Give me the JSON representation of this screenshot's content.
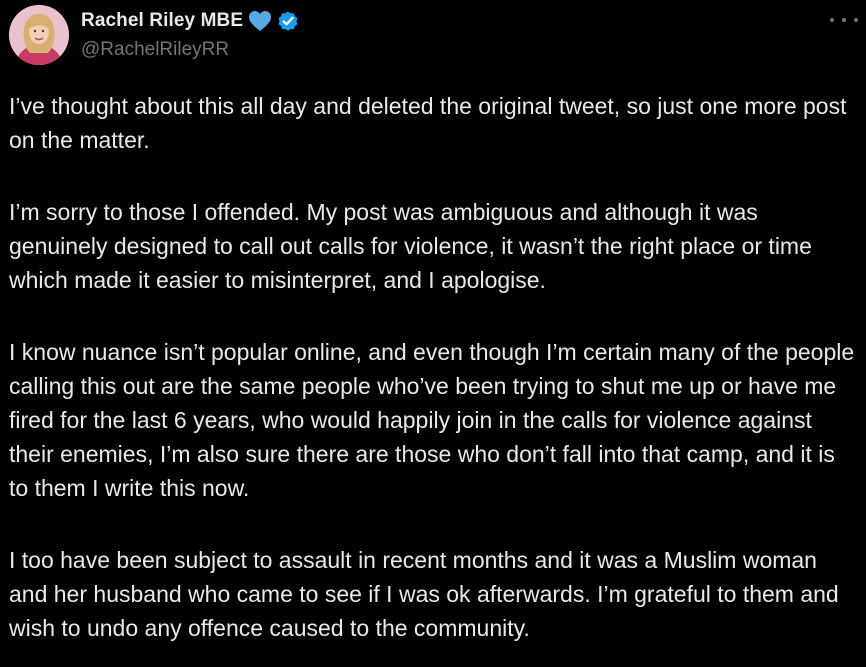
{
  "tweet": {
    "author": {
      "display_name": "Rachel Riley MBE",
      "handle": "@RachelRileyRR",
      "heart_icon": "blue-heart-icon",
      "verified_icon": "verified-badge-icon",
      "verified_color": "#1d9bf0",
      "heart_color": "#5aa9e6"
    },
    "more_icon": "more-horizontal-icon",
    "paragraphs": [
      "I’ve thought about this all day and deleted the original tweet, so just one more post on the matter.",
      "I’m sorry to those I offended. My post was ambiguous and although it was genuinely designed to call out calls for violence, it wasn’t the right place or time which made it easier to misinterpret, and I apologise.",
      "I know nuance isn’t popular online, and even though I’m certain many of the people calling this out are the same people who’ve been trying to shut me up or have me fired for the last 6 years, who would happily join in the calls for violence against their enemies, I’m also sure there are those who don’t fall into that camp, and it is to them I write this now.",
      "I too have been subject to assault in recent months and it was a Muslim woman and her husband who came to see if I was ok afterwards. I’m grateful to them and wish to undo any offence caused to the community."
    ]
  },
  "theme": {
    "background": "#000000",
    "text": "#e7e9ea",
    "secondary_text": "#71767b"
  }
}
